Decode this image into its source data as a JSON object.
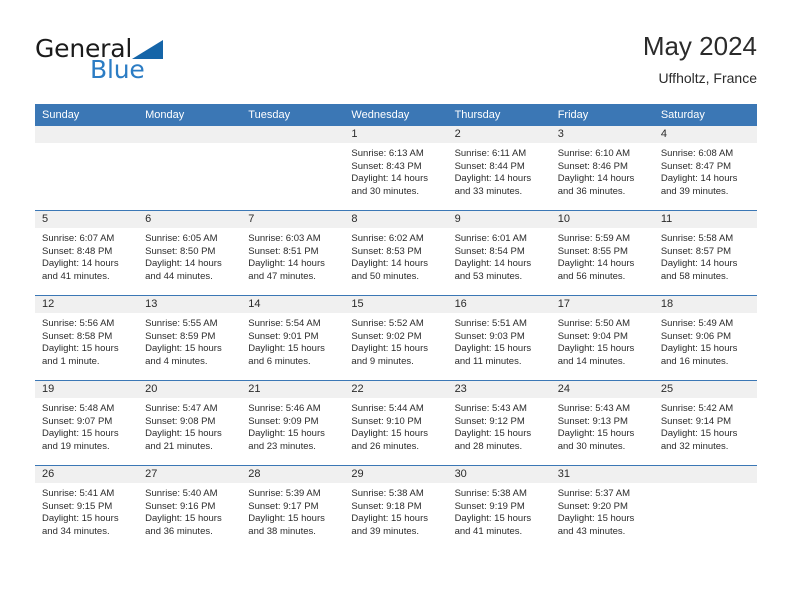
{
  "brand": {
    "word_one": "General",
    "word_two": "Blue",
    "triangle_icon": "triangle-logo-icon",
    "color_dark": "#1b1b1b",
    "color_blue": "#2b7cc4",
    "triangle_color": "#1565a8"
  },
  "header": {
    "title": "May 2024",
    "subtitle": "Uffholtz, France"
  },
  "theme": {
    "header_row_bg": "#3b77b5",
    "header_row_text": "#ffffff",
    "daynum_bg": "#f0f0f0",
    "grid_line": "#3b77b5",
    "body_text": "#2b2b2b"
  },
  "weekdays": [
    "Sunday",
    "Monday",
    "Tuesday",
    "Wednesday",
    "Thursday",
    "Friday",
    "Saturday"
  ],
  "weeks": [
    [
      {
        "day": "",
        "empty": true
      },
      {
        "day": "",
        "empty": true
      },
      {
        "day": "",
        "empty": true
      },
      {
        "day": "1",
        "sunrise": "Sunrise: 6:13 AM",
        "sunset": "Sunset: 8:43 PM",
        "daylight_line1": "Daylight: 14 hours",
        "daylight_line2": "and 30 minutes."
      },
      {
        "day": "2",
        "sunrise": "Sunrise: 6:11 AM",
        "sunset": "Sunset: 8:44 PM",
        "daylight_line1": "Daylight: 14 hours",
        "daylight_line2": "and 33 minutes."
      },
      {
        "day": "3",
        "sunrise": "Sunrise: 6:10 AM",
        "sunset": "Sunset: 8:46 PM",
        "daylight_line1": "Daylight: 14 hours",
        "daylight_line2": "and 36 minutes."
      },
      {
        "day": "4",
        "sunrise": "Sunrise: 6:08 AM",
        "sunset": "Sunset: 8:47 PM",
        "daylight_line1": "Daylight: 14 hours",
        "daylight_line2": "and 39 minutes."
      }
    ],
    [
      {
        "day": "5",
        "sunrise": "Sunrise: 6:07 AM",
        "sunset": "Sunset: 8:48 PM",
        "daylight_line1": "Daylight: 14 hours",
        "daylight_line2": "and 41 minutes."
      },
      {
        "day": "6",
        "sunrise": "Sunrise: 6:05 AM",
        "sunset": "Sunset: 8:50 PM",
        "daylight_line1": "Daylight: 14 hours",
        "daylight_line2": "and 44 minutes."
      },
      {
        "day": "7",
        "sunrise": "Sunrise: 6:03 AM",
        "sunset": "Sunset: 8:51 PM",
        "daylight_line1": "Daylight: 14 hours",
        "daylight_line2": "and 47 minutes."
      },
      {
        "day": "8",
        "sunrise": "Sunrise: 6:02 AM",
        "sunset": "Sunset: 8:53 PM",
        "daylight_line1": "Daylight: 14 hours",
        "daylight_line2": "and 50 minutes."
      },
      {
        "day": "9",
        "sunrise": "Sunrise: 6:01 AM",
        "sunset": "Sunset: 8:54 PM",
        "daylight_line1": "Daylight: 14 hours",
        "daylight_line2": "and 53 minutes."
      },
      {
        "day": "10",
        "sunrise": "Sunrise: 5:59 AM",
        "sunset": "Sunset: 8:55 PM",
        "daylight_line1": "Daylight: 14 hours",
        "daylight_line2": "and 56 minutes."
      },
      {
        "day": "11",
        "sunrise": "Sunrise: 5:58 AM",
        "sunset": "Sunset: 8:57 PM",
        "daylight_line1": "Daylight: 14 hours",
        "daylight_line2": "and 58 minutes."
      }
    ],
    [
      {
        "day": "12",
        "sunrise": "Sunrise: 5:56 AM",
        "sunset": "Sunset: 8:58 PM",
        "daylight_line1": "Daylight: 15 hours",
        "daylight_line2": "and 1 minute."
      },
      {
        "day": "13",
        "sunrise": "Sunrise: 5:55 AM",
        "sunset": "Sunset: 8:59 PM",
        "daylight_line1": "Daylight: 15 hours",
        "daylight_line2": "and 4 minutes."
      },
      {
        "day": "14",
        "sunrise": "Sunrise: 5:54 AM",
        "sunset": "Sunset: 9:01 PM",
        "daylight_line1": "Daylight: 15 hours",
        "daylight_line2": "and 6 minutes."
      },
      {
        "day": "15",
        "sunrise": "Sunrise: 5:52 AM",
        "sunset": "Sunset: 9:02 PM",
        "daylight_line1": "Daylight: 15 hours",
        "daylight_line2": "and 9 minutes."
      },
      {
        "day": "16",
        "sunrise": "Sunrise: 5:51 AM",
        "sunset": "Sunset: 9:03 PM",
        "daylight_line1": "Daylight: 15 hours",
        "daylight_line2": "and 11 minutes."
      },
      {
        "day": "17",
        "sunrise": "Sunrise: 5:50 AM",
        "sunset": "Sunset: 9:04 PM",
        "daylight_line1": "Daylight: 15 hours",
        "daylight_line2": "and 14 minutes."
      },
      {
        "day": "18",
        "sunrise": "Sunrise: 5:49 AM",
        "sunset": "Sunset: 9:06 PM",
        "daylight_line1": "Daylight: 15 hours",
        "daylight_line2": "and 16 minutes."
      }
    ],
    [
      {
        "day": "19",
        "sunrise": "Sunrise: 5:48 AM",
        "sunset": "Sunset: 9:07 PM",
        "daylight_line1": "Daylight: 15 hours",
        "daylight_line2": "and 19 minutes."
      },
      {
        "day": "20",
        "sunrise": "Sunrise: 5:47 AM",
        "sunset": "Sunset: 9:08 PM",
        "daylight_line1": "Daylight: 15 hours",
        "daylight_line2": "and 21 minutes."
      },
      {
        "day": "21",
        "sunrise": "Sunrise: 5:46 AM",
        "sunset": "Sunset: 9:09 PM",
        "daylight_line1": "Daylight: 15 hours",
        "daylight_line2": "and 23 minutes."
      },
      {
        "day": "22",
        "sunrise": "Sunrise: 5:44 AM",
        "sunset": "Sunset: 9:10 PM",
        "daylight_line1": "Daylight: 15 hours",
        "daylight_line2": "and 26 minutes."
      },
      {
        "day": "23",
        "sunrise": "Sunrise: 5:43 AM",
        "sunset": "Sunset: 9:12 PM",
        "daylight_line1": "Daylight: 15 hours",
        "daylight_line2": "and 28 minutes."
      },
      {
        "day": "24",
        "sunrise": "Sunrise: 5:43 AM",
        "sunset": "Sunset: 9:13 PM",
        "daylight_line1": "Daylight: 15 hours",
        "daylight_line2": "and 30 minutes."
      },
      {
        "day": "25",
        "sunrise": "Sunrise: 5:42 AM",
        "sunset": "Sunset: 9:14 PM",
        "daylight_line1": "Daylight: 15 hours",
        "daylight_line2": "and 32 minutes."
      }
    ],
    [
      {
        "day": "26",
        "sunrise": "Sunrise: 5:41 AM",
        "sunset": "Sunset: 9:15 PM",
        "daylight_line1": "Daylight: 15 hours",
        "daylight_line2": "and 34 minutes."
      },
      {
        "day": "27",
        "sunrise": "Sunrise: 5:40 AM",
        "sunset": "Sunset: 9:16 PM",
        "daylight_line1": "Daylight: 15 hours",
        "daylight_line2": "and 36 minutes."
      },
      {
        "day": "28",
        "sunrise": "Sunrise: 5:39 AM",
        "sunset": "Sunset: 9:17 PM",
        "daylight_line1": "Daylight: 15 hours",
        "daylight_line2": "and 38 minutes."
      },
      {
        "day": "29",
        "sunrise": "Sunrise: 5:38 AM",
        "sunset": "Sunset: 9:18 PM",
        "daylight_line1": "Daylight: 15 hours",
        "daylight_line2": "and 39 minutes."
      },
      {
        "day": "30",
        "sunrise": "Sunrise: 5:38 AM",
        "sunset": "Sunset: 9:19 PM",
        "daylight_line1": "Daylight: 15 hours",
        "daylight_line2": "and 41 minutes."
      },
      {
        "day": "31",
        "sunrise": "Sunrise: 5:37 AM",
        "sunset": "Sunset: 9:20 PM",
        "daylight_line1": "Daylight: 15 hours",
        "daylight_line2": "and 43 minutes."
      },
      {
        "day": "",
        "empty": true
      }
    ]
  ]
}
